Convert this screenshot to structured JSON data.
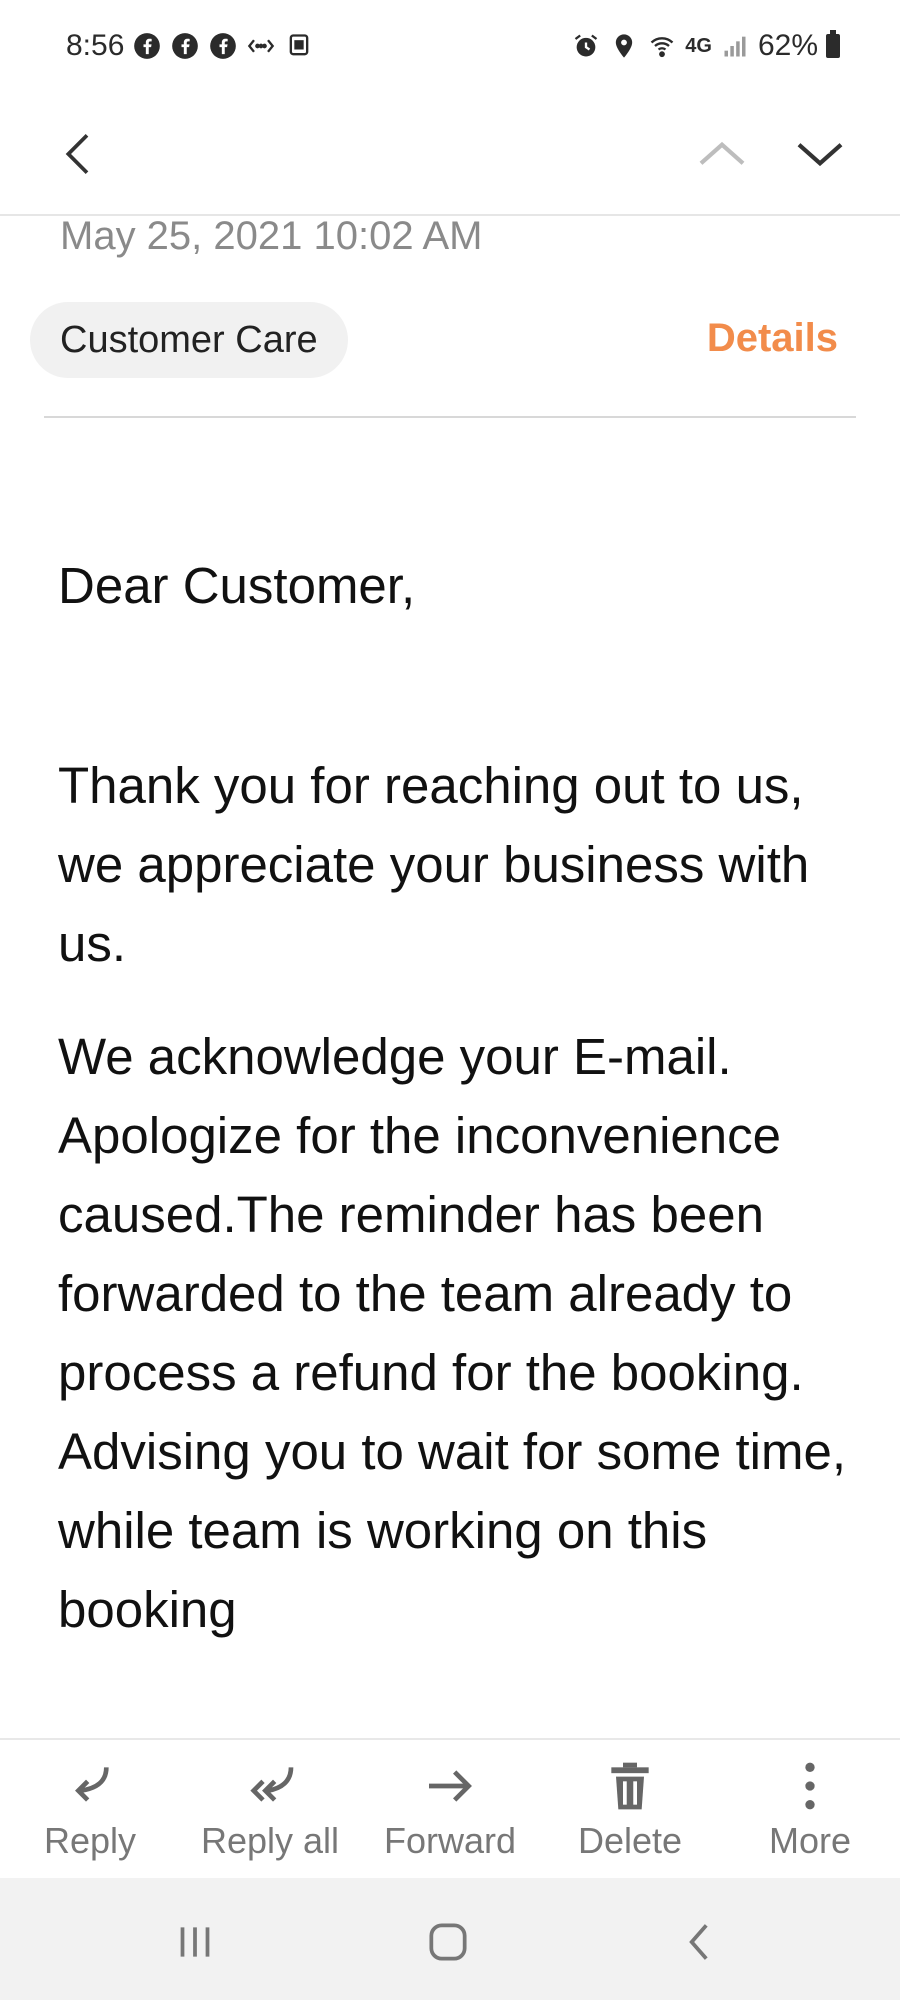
{
  "status_bar": {
    "time": "8:56",
    "battery_percent": "62%",
    "network": "4G"
  },
  "toolbar": {
    "back_icon": "chevron-left-icon",
    "prev_icon": "chevron-up-icon",
    "next_icon": "chevron-down-icon"
  },
  "message": {
    "date": "May 25, 2021  10:02 AM",
    "sender": "Customer Care",
    "details_label": "Details",
    "greeting": "Dear Customer,",
    "paragraphs": [
      "Thank you for reaching out to us, we appreciate your business with us.",
      "We acknowledge your E-mail. Apologize for the inconvenience caused.The reminder has been forwarded to the team already to process a refund for the booking. Advising you to wait for some time, while team is working on this booking"
    ]
  },
  "actions": [
    {
      "label": "Reply",
      "icon": "reply-icon"
    },
    {
      "label": "Reply all",
      "icon": "reply-all-icon"
    },
    {
      "label": "Forward",
      "icon": "forward-icon"
    },
    {
      "label": "Delete",
      "icon": "trash-icon"
    },
    {
      "label": "More",
      "icon": "more-vertical-icon"
    }
  ],
  "nav": {
    "recent_icon": "recent-apps-icon",
    "home_icon": "home-icon",
    "back_icon": "back-icon"
  },
  "colors": {
    "accent": "#f28c4b",
    "disabled": "#bdbdbd"
  }
}
